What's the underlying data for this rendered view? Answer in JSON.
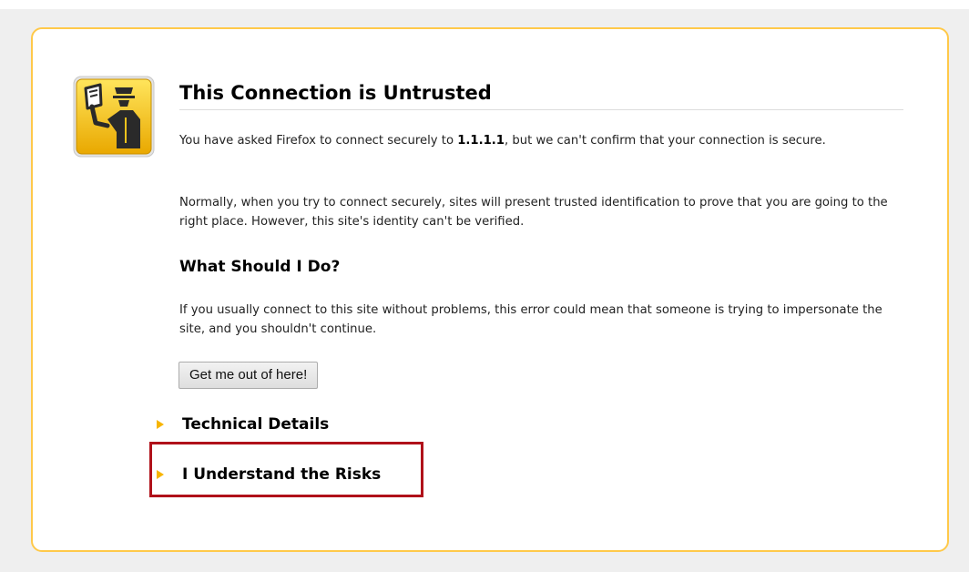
{
  "page": {
    "title": "This Connection is Untrusted",
    "intro_prefix": "You have asked Firefox to connect securely to ",
    "intro_host": "1.1.1.1",
    "intro_suffix": ", but we can't confirm that your connection is secure.",
    "normally_text": "Normally, when you try to connect securely, sites will present trusted identification to prove that you are going to the right place. However, this site's identity can't be verified.",
    "what_heading": "What Should I Do?",
    "what_text": "If you usually connect to this site without problems, this error could mean that someone is trying to impersonate the site, and you shouldn't continue.",
    "get_out_button": "Get me out of here!"
  },
  "expanders": [
    {
      "label": "Technical Details",
      "icon": "expand-arrow-icon"
    },
    {
      "label": "I Understand the Risks",
      "icon": "expand-arrow-icon"
    }
  ],
  "icons": {
    "main": "certificate-officer-icon"
  },
  "colors": {
    "box_border": "#ffc94a",
    "page_background": "#efefef",
    "arrow": "#f7b500",
    "highlight": "#b0111a",
    "icon_yellow": "#f6c51c"
  }
}
